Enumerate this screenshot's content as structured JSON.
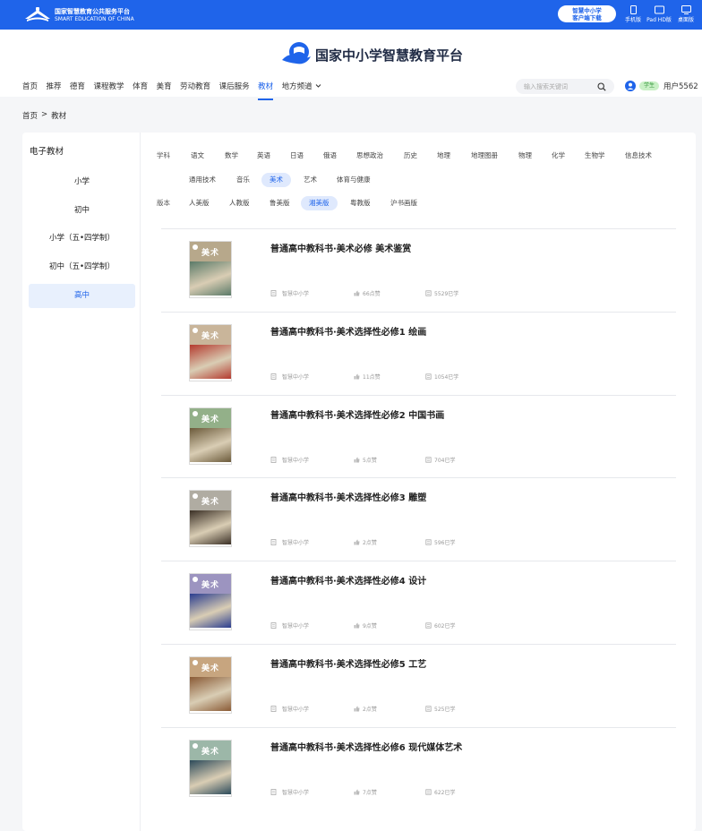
{
  "topbar": {
    "site_name": "国家智慧教育公共服务平台",
    "site_name_en": "SMART EDUCATION OF CHINA",
    "download_line1": "智慧中小学",
    "download_line2": "客户端下载",
    "devices": [
      "手机版",
      "Pad HD版",
      "桌面版"
    ]
  },
  "header": {
    "title": "国家中小学智慧教育平台",
    "nav": [
      "首页",
      "推荐",
      "德育",
      "课程教学",
      "体育",
      "美育",
      "劳动教育",
      "课后服务",
      "教材",
      "地方频道"
    ],
    "nav_active_index": 8,
    "search_placeholder": "输入搜索关键词",
    "role": "学生",
    "username": "用户5562"
  },
  "breadcrumb": {
    "home": "首页",
    "sep": ">",
    "current": "教材"
  },
  "sidebar": {
    "title": "电子教材",
    "items": [
      "小学",
      "初中",
      "小学（五•四学制）",
      "初中（五•四学制）",
      "高中"
    ],
    "active_index": 4
  },
  "filters": {
    "subject_label": "学科",
    "subjects": [
      "语文",
      "数学",
      "英语",
      "日语",
      "俄语",
      "思想政治",
      "历史",
      "地理",
      "地理图册",
      "物理",
      "化学",
      "生物学",
      "信息技术",
      "通用技术",
      "音乐",
      "美术",
      "艺术",
      "体育与健康"
    ],
    "subject_active": "美术",
    "version_label": "版本",
    "versions": [
      "人美版",
      "人教版",
      "鲁美版",
      "湘美版",
      "粤教版",
      "沪书画版"
    ],
    "version_active": "湘美版"
  },
  "books": [
    {
      "title": "普通高中教科书·美术必修 美术鉴赏",
      "source": "智慧中小学",
      "likes": "66点赞",
      "learners": "5529已学",
      "cover_tab": "#b7a88b",
      "cover_art": "#5a7a68"
    },
    {
      "title": "普通高中教科书·美术选择性必修1 绘画",
      "source": "智慧中小学",
      "likes": "11点赞",
      "learners": "1054已学",
      "cover_tab": "#c9b59a",
      "cover_art": "#b43a2e"
    },
    {
      "title": "普通高中教科书·美术选择性必修2 中国书画",
      "source": "智慧中小学",
      "likes": "5点赞",
      "learners": "704已学",
      "cover_tab": "#93b089",
      "cover_art": "#6b5a3a"
    },
    {
      "title": "普通高中教科书·美术选择性必修3 雕塑",
      "source": "智慧中小学",
      "likes": "2点赞",
      "learners": "596已学",
      "cover_tab": "#b0aca2",
      "cover_art": "#3a2f25"
    },
    {
      "title": "普通高中教科书·美术选择性必修4 设计",
      "source": "智慧中小学",
      "likes": "9点赞",
      "learners": "602已学",
      "cover_tab": "#9c94c0",
      "cover_art": "#2a3d8f"
    },
    {
      "title": "普通高中教科书·美术选择性必修5 工艺",
      "source": "智慧中小学",
      "likes": "2点赞",
      "learners": "525已学",
      "cover_tab": "#c7a57f",
      "cover_art": "#8a5a35"
    },
    {
      "title": "普通高中教科书·美术选择性必修6 现代媒体艺术",
      "source": "智慧中小学",
      "likes": "7点赞",
      "learners": "622已学",
      "cover_tab": "#9cb7a8",
      "cover_art": "#2c4a5a"
    }
  ],
  "cover_text": "美术"
}
